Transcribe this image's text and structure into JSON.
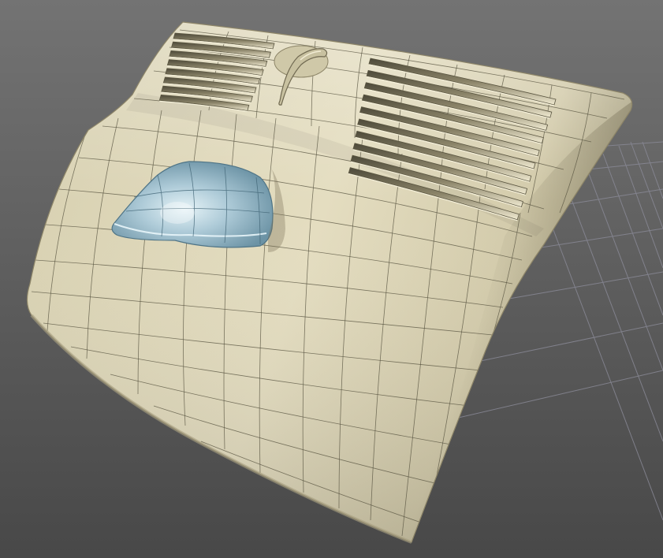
{
  "viewport": {
    "background_top": "#727272",
    "background_bottom": "#4a4a4a",
    "grid_color": "#8a8a9a"
  },
  "model": {
    "surface_base": "#d6cfb0",
    "surface_light": "#ece6cc",
    "surface_shadow": "#8d8568",
    "wire_color": "#55523f",
    "vents_left_count": 8,
    "vents_right_count": 10,
    "selected_part": {
      "fill": "#a9c8d6",
      "highlight": "#dceef4",
      "shadow": "#5f8799"
    }
  }
}
